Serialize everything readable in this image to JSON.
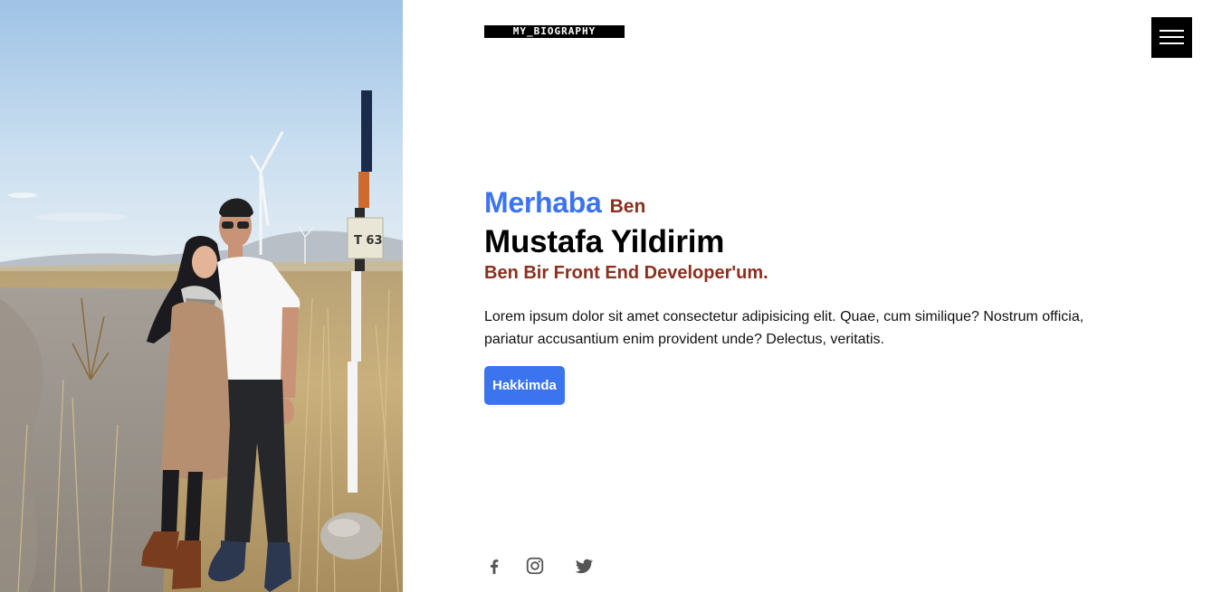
{
  "header": {
    "logo_text": "MY_BIOGRAPHY",
    "menu_icon": "hamburger-menu-icon"
  },
  "photo": {
    "sign_text": "T 63"
  },
  "hero": {
    "greeting": "Merhaba",
    "greeting_suffix": "Ben",
    "name": "Mustafa Yildirim",
    "role": "Ben Bir Front End Developer'um.",
    "description": "Lorem ipsum dolor sit amet consectetur adipisicing elit. Quae, cum similique? Nostrum officia, pariatur accusantium enim provident unde? Delectus, veritatis.",
    "button_label": "Hakkimda"
  },
  "social": {
    "icons": [
      "facebook-icon",
      "instagram-icon",
      "twitter-icon"
    ]
  },
  "colors": {
    "accent_blue": "#3b74ee",
    "accent_brown": "#8b2f1f",
    "text": "#000000",
    "social_gray": "#555555"
  }
}
